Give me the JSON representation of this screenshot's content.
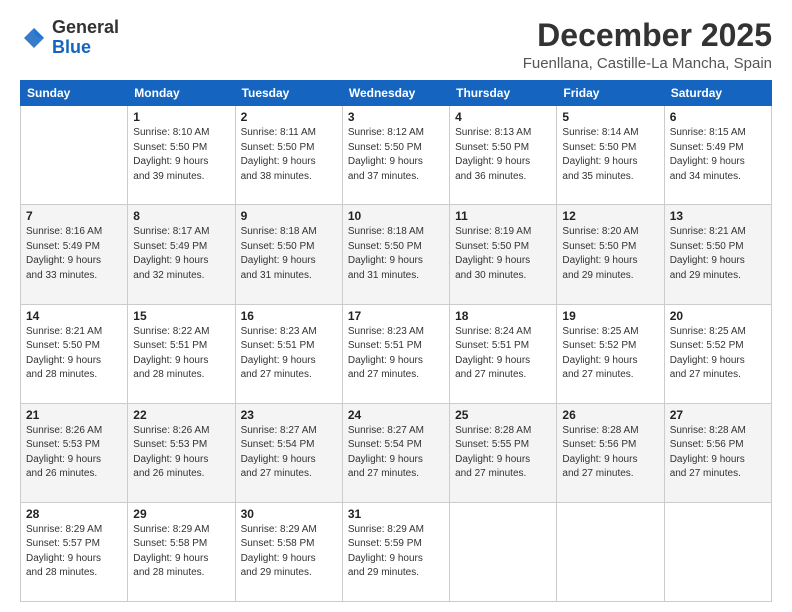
{
  "header": {
    "logo_general": "General",
    "logo_blue": "Blue",
    "month": "December 2025",
    "location": "Fuenllana, Castille-La Mancha, Spain"
  },
  "weekdays": [
    "Sunday",
    "Monday",
    "Tuesday",
    "Wednesday",
    "Thursday",
    "Friday",
    "Saturday"
  ],
  "weeks": [
    [
      {
        "day": "",
        "info": ""
      },
      {
        "day": "1",
        "info": "Sunrise: 8:10 AM\nSunset: 5:50 PM\nDaylight: 9 hours\nand 39 minutes."
      },
      {
        "day": "2",
        "info": "Sunrise: 8:11 AM\nSunset: 5:50 PM\nDaylight: 9 hours\nand 38 minutes."
      },
      {
        "day": "3",
        "info": "Sunrise: 8:12 AM\nSunset: 5:50 PM\nDaylight: 9 hours\nand 37 minutes."
      },
      {
        "day": "4",
        "info": "Sunrise: 8:13 AM\nSunset: 5:50 PM\nDaylight: 9 hours\nand 36 minutes."
      },
      {
        "day": "5",
        "info": "Sunrise: 8:14 AM\nSunset: 5:50 PM\nDaylight: 9 hours\nand 35 minutes."
      },
      {
        "day": "6",
        "info": "Sunrise: 8:15 AM\nSunset: 5:49 PM\nDaylight: 9 hours\nand 34 minutes."
      }
    ],
    [
      {
        "day": "7",
        "info": "Sunrise: 8:16 AM\nSunset: 5:49 PM\nDaylight: 9 hours\nand 33 minutes."
      },
      {
        "day": "8",
        "info": "Sunrise: 8:17 AM\nSunset: 5:49 PM\nDaylight: 9 hours\nand 32 minutes."
      },
      {
        "day": "9",
        "info": "Sunrise: 8:18 AM\nSunset: 5:50 PM\nDaylight: 9 hours\nand 31 minutes."
      },
      {
        "day": "10",
        "info": "Sunrise: 8:18 AM\nSunset: 5:50 PM\nDaylight: 9 hours\nand 31 minutes."
      },
      {
        "day": "11",
        "info": "Sunrise: 8:19 AM\nSunset: 5:50 PM\nDaylight: 9 hours\nand 30 minutes."
      },
      {
        "day": "12",
        "info": "Sunrise: 8:20 AM\nSunset: 5:50 PM\nDaylight: 9 hours\nand 29 minutes."
      },
      {
        "day": "13",
        "info": "Sunrise: 8:21 AM\nSunset: 5:50 PM\nDaylight: 9 hours\nand 29 minutes."
      }
    ],
    [
      {
        "day": "14",
        "info": "Sunrise: 8:21 AM\nSunset: 5:50 PM\nDaylight: 9 hours\nand 28 minutes."
      },
      {
        "day": "15",
        "info": "Sunrise: 8:22 AM\nSunset: 5:51 PM\nDaylight: 9 hours\nand 28 minutes."
      },
      {
        "day": "16",
        "info": "Sunrise: 8:23 AM\nSunset: 5:51 PM\nDaylight: 9 hours\nand 27 minutes."
      },
      {
        "day": "17",
        "info": "Sunrise: 8:23 AM\nSunset: 5:51 PM\nDaylight: 9 hours\nand 27 minutes."
      },
      {
        "day": "18",
        "info": "Sunrise: 8:24 AM\nSunset: 5:51 PM\nDaylight: 9 hours\nand 27 minutes."
      },
      {
        "day": "19",
        "info": "Sunrise: 8:25 AM\nSunset: 5:52 PM\nDaylight: 9 hours\nand 27 minutes."
      },
      {
        "day": "20",
        "info": "Sunrise: 8:25 AM\nSunset: 5:52 PM\nDaylight: 9 hours\nand 27 minutes."
      }
    ],
    [
      {
        "day": "21",
        "info": "Sunrise: 8:26 AM\nSunset: 5:53 PM\nDaylight: 9 hours\nand 26 minutes."
      },
      {
        "day": "22",
        "info": "Sunrise: 8:26 AM\nSunset: 5:53 PM\nDaylight: 9 hours\nand 26 minutes."
      },
      {
        "day": "23",
        "info": "Sunrise: 8:27 AM\nSunset: 5:54 PM\nDaylight: 9 hours\nand 27 minutes."
      },
      {
        "day": "24",
        "info": "Sunrise: 8:27 AM\nSunset: 5:54 PM\nDaylight: 9 hours\nand 27 minutes."
      },
      {
        "day": "25",
        "info": "Sunrise: 8:28 AM\nSunset: 5:55 PM\nDaylight: 9 hours\nand 27 minutes."
      },
      {
        "day": "26",
        "info": "Sunrise: 8:28 AM\nSunset: 5:56 PM\nDaylight: 9 hours\nand 27 minutes."
      },
      {
        "day": "27",
        "info": "Sunrise: 8:28 AM\nSunset: 5:56 PM\nDaylight: 9 hours\nand 27 minutes."
      }
    ],
    [
      {
        "day": "28",
        "info": "Sunrise: 8:29 AM\nSunset: 5:57 PM\nDaylight: 9 hours\nand 28 minutes."
      },
      {
        "day": "29",
        "info": "Sunrise: 8:29 AM\nSunset: 5:58 PM\nDaylight: 9 hours\nand 28 minutes."
      },
      {
        "day": "30",
        "info": "Sunrise: 8:29 AM\nSunset: 5:58 PM\nDaylight: 9 hours\nand 29 minutes."
      },
      {
        "day": "31",
        "info": "Sunrise: 8:29 AM\nSunset: 5:59 PM\nDaylight: 9 hours\nand 29 minutes."
      },
      {
        "day": "",
        "info": ""
      },
      {
        "day": "",
        "info": ""
      },
      {
        "day": "",
        "info": ""
      }
    ]
  ]
}
